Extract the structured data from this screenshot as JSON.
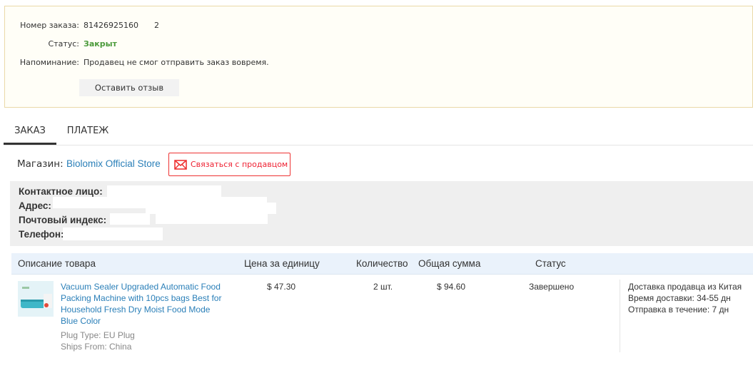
{
  "order": {
    "number_label": "Номер заказа:",
    "number_value": "81426925160",
    "number_suffix": "2",
    "status_label": "Статус:",
    "status_value": "Закрыт",
    "reminder_label": "Напоминание:",
    "reminder_value": "Продавец не смог отправить заказ вовремя.",
    "review_button": "Оставить отзыв"
  },
  "tabs": [
    {
      "label": "ЗАКАЗ",
      "active": true
    },
    {
      "label": "ПЛАТЕЖ",
      "active": false
    }
  ],
  "store": {
    "label": "Магазин:",
    "name": "Biolomix Official Store",
    "contact_button": "Связаться с продавцом"
  },
  "address": {
    "contact_label": "Контактное лицо:",
    "address_label": "Адрес:",
    "postal_label": "Почтовый индекс:",
    "phone_label": "Телефон:"
  },
  "table": {
    "headers": {
      "description": "Описание товара",
      "unit_price": "Цена за единицу",
      "quantity": "Количество",
      "total": "Общая сумма",
      "status": "Статус"
    },
    "rows": [
      {
        "title": "Vacuum Sealer Upgraded Automatic Food Packing Machine with 10pcs bags Best for Household Fresh Dry Moist Food Mode Blue Color",
        "prop1": "Plug Type: EU Plug",
        "prop2": "Ships From: China",
        "unit_price": "$ 47.30",
        "quantity": "2 шт.",
        "total": "$ 94.60",
        "status": "Завершено",
        "ship_line1": "Доставка продавца из Китая",
        "ship_line2": "Время доставки: 34-55 дн",
        "ship_line3": "Отправка в течение: 7 дн"
      }
    ]
  },
  "colors": {
    "link": "#2a7fb8",
    "status_closed": "#4a9a3a",
    "contact_red": "#e33333"
  }
}
